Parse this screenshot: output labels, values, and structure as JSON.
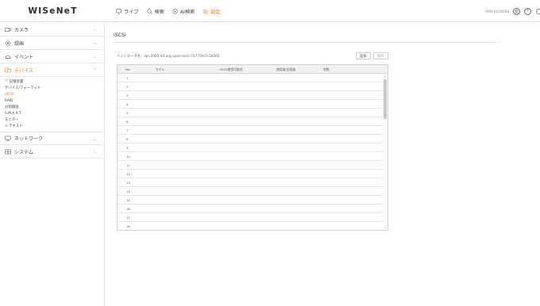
{
  "brand": {
    "logo_text": "WISeNeT"
  },
  "nav": {
    "items": [
      {
        "label": "ライブ",
        "icon": "monitor-icon"
      },
      {
        "label": "検索",
        "icon": "search-icon"
      },
      {
        "label": "AI検索",
        "icon": "ai-search-icon"
      },
      {
        "label": "設定",
        "icon": "gear-icon"
      }
    ],
    "active_index": 3
  },
  "header_right": {
    "user_id": "XRN-6410DB4",
    "help_glyph": "?"
  },
  "sidebar": {
    "menu": [
      {
        "label": "カメラ",
        "icon": "camera-icon",
        "expanded": false
      },
      {
        "label": "録画",
        "icon": "record-icon",
        "expanded": false
      },
      {
        "label": "イベント",
        "icon": "event-icon",
        "expanded": false
      },
      {
        "label": "デバイス",
        "icon": "device-icon",
        "expanded": true
      },
      {
        "label": "ネットワーク",
        "icon": "network-icon",
        "expanded": false
      },
      {
        "label": "システム",
        "icon": "system-icon",
        "expanded": false
      }
    ],
    "device_sub": [
      {
        "label": "﹀ 記憶装置"
      },
      {
        "label": "デバイス/フォーマット"
      },
      {
        "label": "iSCSI"
      },
      {
        "label": "RAID"
      },
      {
        "label": "分割録画"
      },
      {
        "label": "S.M.A.R.T"
      },
      {
        "label": "モニター"
      },
      {
        "label": "> テキスト"
      }
    ],
    "active_sub_index": 2
  },
  "main": {
    "title": "iSCSI",
    "initiator_text": "イニシエータ名：iqn.2005-03.org.open-iscsi:74775fe7c1b566",
    "add_button": "追加",
    "delete_button": "削除",
    "columns": [
      "No.",
      "モデル",
      "iSCSI使用可能名",
      "使用量/全容量",
      "状態"
    ],
    "rows": [
      "1",
      "2",
      "3",
      "4",
      "5",
      "6",
      "7",
      "8",
      "9",
      "10",
      "11",
      "12",
      "13",
      "14",
      "15",
      "16",
      "17",
      "18"
    ]
  },
  "colors": {
    "accent": "#f07b28",
    "border": "#e3e3e3",
    "header_bg": "#f1f1f1"
  }
}
